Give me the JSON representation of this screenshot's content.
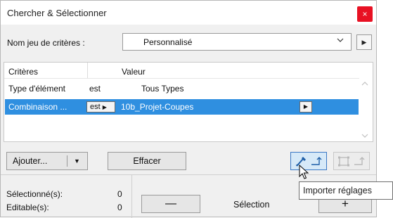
{
  "window": {
    "title": "Chercher & Sélectionner",
    "close_glyph": "×"
  },
  "criteria_set": {
    "label": "Nom jeu de critères :",
    "value": "Personnalisé"
  },
  "table": {
    "headers": {
      "criteria": "Critères",
      "value": "Valeur"
    },
    "rows": [
      {
        "criterion": "Type d'élément",
        "operator": "est",
        "value": "Tous Types"
      },
      {
        "criterion": "Combinaison ...",
        "operator": "est",
        "value": "10b_Projet-Coupes"
      }
    ]
  },
  "buttons": {
    "add": "Ajouter...",
    "clear": "Effacer",
    "minus": "—",
    "plus": "+"
  },
  "stats": {
    "selected_label": "Sélectionné(s):",
    "selected_value": "0",
    "editable_label": "Editable(s):",
    "editable_value": "0",
    "selection_label": "Sélection"
  },
  "tooltip": "Importer réglages",
  "colors": {
    "selected_row": "#2f8fe0",
    "close": "#e81123",
    "icon_blue": "#1f5fa8"
  }
}
